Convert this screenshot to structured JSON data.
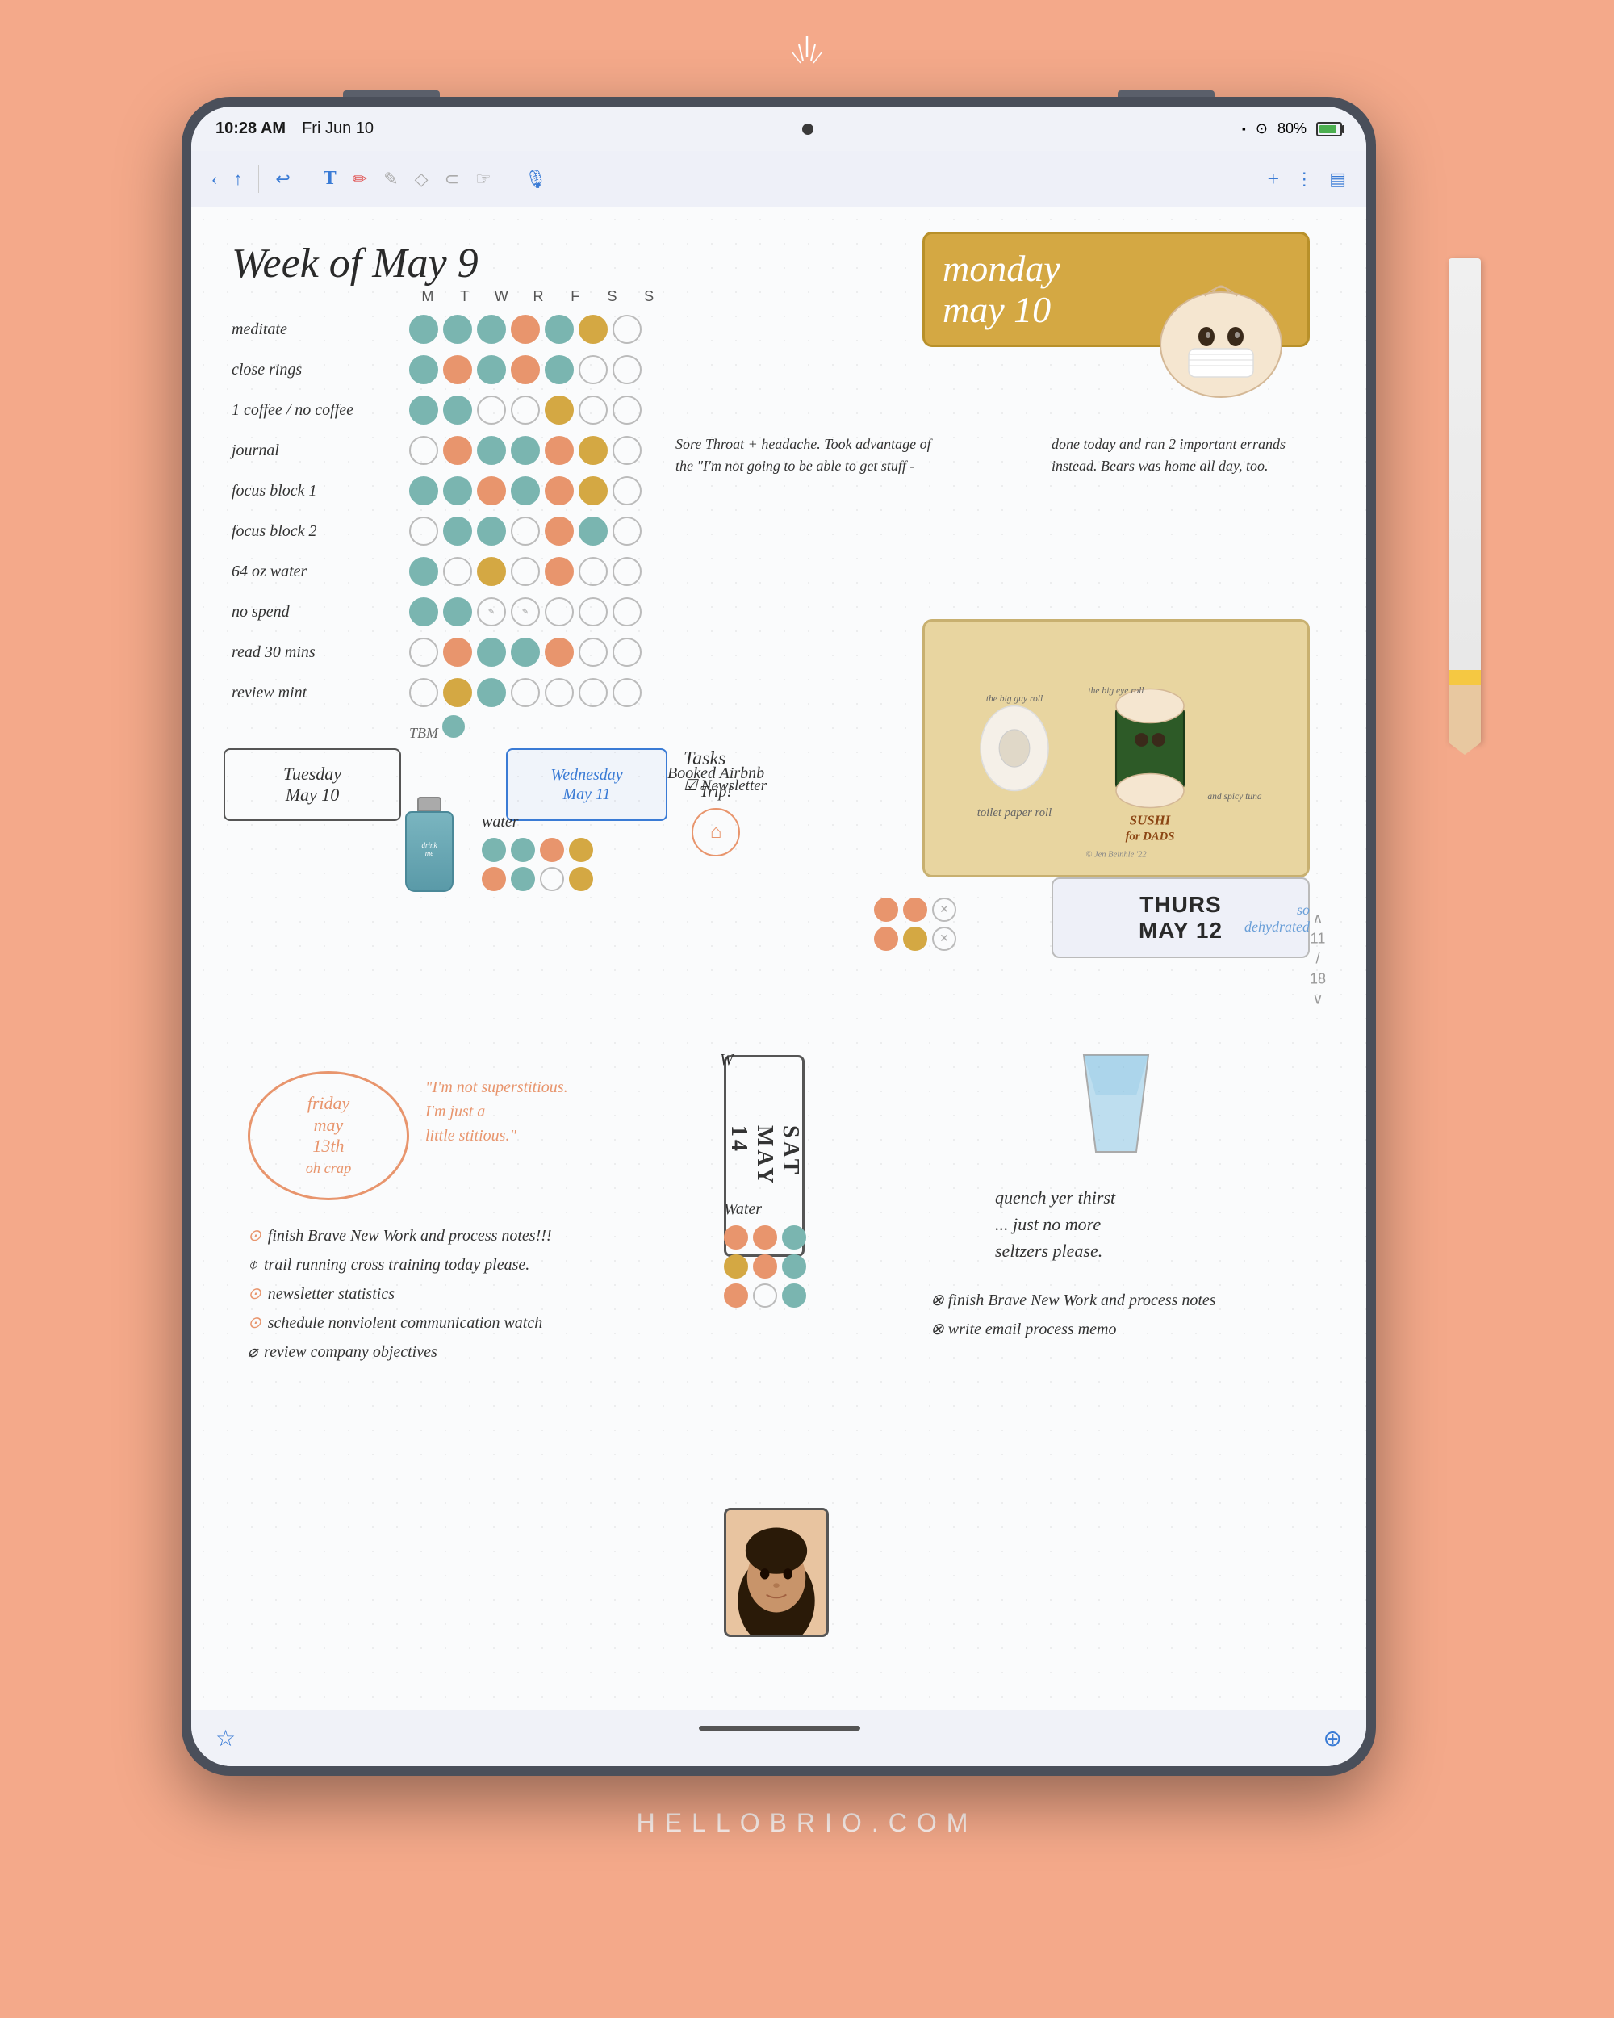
{
  "page": {
    "background_color": "#F4A98A",
    "branding": "HELLOBRIO.COM"
  },
  "status_bar": {
    "time": "10:28 AM",
    "date": "Fri Jun 10",
    "battery": "80%",
    "signal": "●"
  },
  "toolbar": {
    "back_label": "‹",
    "share_label": "↑",
    "undo_label": "↩",
    "text_label": "T",
    "pen_label": "✏",
    "pencil_label": "✎",
    "eraser_label": "◇",
    "lasso_label": "○",
    "finger_label": "☞",
    "mic_label": "⬤",
    "add_label": "+",
    "more_label": "⋮",
    "sidebar_label": "▤"
  },
  "journal": {
    "week_title": "Week of May 9",
    "habit_days": [
      "M",
      "T",
      "W",
      "R",
      "F",
      "S",
      "S"
    ],
    "habits": [
      {
        "name": "meditate",
        "filled": [
          true,
          true,
          true,
          true,
          true,
          true,
          false
        ]
      },
      {
        "name": "close rings",
        "filled": [
          true,
          true,
          true,
          true,
          true,
          false,
          false
        ]
      },
      {
        "name": "1 coffee / no coffee",
        "filled": [
          true,
          true,
          false,
          false,
          true,
          false,
          false
        ]
      },
      {
        "name": "journal",
        "filled": [
          false,
          true,
          true,
          true,
          true,
          true,
          false
        ]
      },
      {
        "name": "focus block 1",
        "filled": [
          true,
          true,
          true,
          true,
          true,
          false,
          false
        ]
      },
      {
        "name": "focus block 2",
        "filled": [
          false,
          true,
          true,
          false,
          true,
          false,
          false
        ]
      },
      {
        "name": "64 oz water",
        "filled": [
          true,
          false,
          true,
          false,
          true,
          false,
          false
        ]
      },
      {
        "name": "no spend",
        "filled": [
          true,
          true,
          false,
          false,
          false,
          false,
          false
        ]
      },
      {
        "name": "read 30 mins",
        "filled": [
          false,
          true,
          true,
          true,
          true,
          false,
          false
        ]
      },
      {
        "name": "review mint",
        "filled": [
          false,
          true,
          true,
          false,
          false,
          false,
          false
        ]
      }
    ],
    "monday": {
      "title": "monday\nmay 10",
      "note1": "Sore Throat + headache. Took advantage of the \"I'm not going to be able to get stuff -",
      "note2": "done today and ran 2 important errands instead. Bears was home all day, too."
    },
    "sushi_caption": "Sushi for Dads",
    "tuesday": {
      "title": "Tuesday\nMay 10"
    },
    "wednesday": {
      "title": "Wednesday\nMay 11"
    },
    "water_label": "water",
    "tasks": {
      "title": "Tasks",
      "items": [
        "✓ Newsletter"
      ]
    },
    "airbnb_note": "Booked Airbnb\nTrip!",
    "thursday": {
      "title": "THURS\nMAY 12"
    },
    "friday": {
      "title": "friday\nmay\n13th\non crap"
    },
    "quote": "\"I'm not superstitious.\nI'm just a\nlittle stitious.\"",
    "saturday": {
      "title": "SAT\nMAY\n14"
    },
    "water_tracker_label": "Water",
    "quench_text": "quench yer thirst\n... just no more\nseltzers please.",
    "friday_tasks": [
      "◎ finish Brave New Work and process notes!!!",
      "⌽ trail running cross training today please.",
      "⊙ newsletter statistics",
      "⊙ schedule nonviolent communication watch",
      "⌀ review company objectives"
    ],
    "saturday_tasks": [
      "⊗ finish Brave New Work and process notes",
      "⊗ write email process memo"
    ],
    "tbm_label": "TBM ◎",
    "page_numbers": "11\n/\n18",
    "dehydrated_label": "so\ndehydrated"
  }
}
